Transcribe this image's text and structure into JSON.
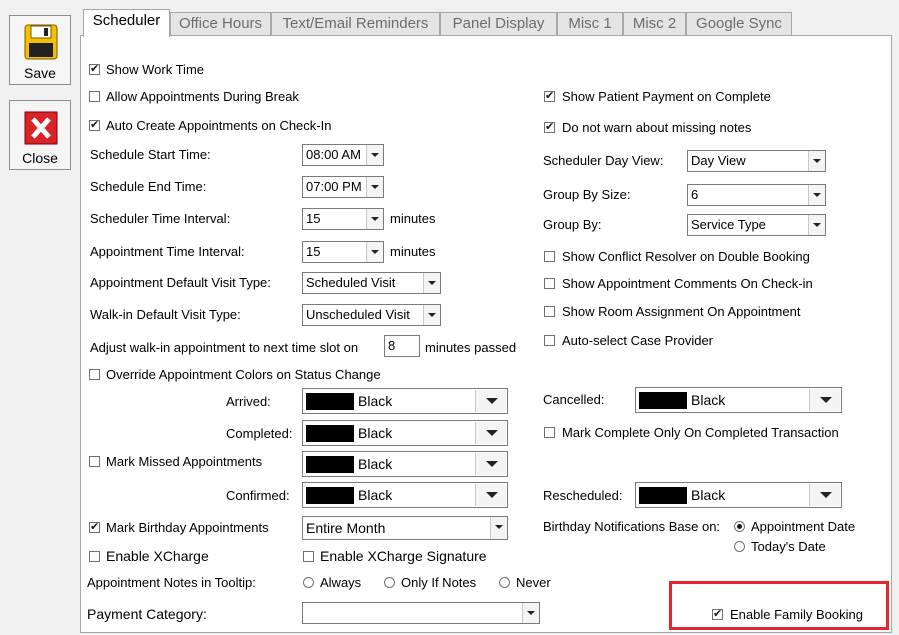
{
  "toolbar": {
    "save_label": "Save",
    "close_label": "Close"
  },
  "tabs": [
    {
      "label": "Scheduler",
      "active": true
    },
    {
      "label": "Office Hours",
      "active": false
    },
    {
      "label": "Text/Email Reminders",
      "active": false
    },
    {
      "label": "Panel Display",
      "active": false
    },
    {
      "label": "Misc 1",
      "active": false
    },
    {
      "label": "Misc 2",
      "active": false
    },
    {
      "label": "Google Sync",
      "active": false
    }
  ],
  "left": {
    "show_work_time": {
      "label": "Show Work Time",
      "checked": true
    },
    "allow_during_break": {
      "label": "Allow Appointments During Break",
      "checked": false
    },
    "auto_create": {
      "label": "Auto Create Appointments on Check-In",
      "checked": true
    },
    "start_time": {
      "label": "Schedule Start Time:",
      "value": "08:00 AM"
    },
    "end_time": {
      "label": "Schedule End Time:",
      "value": "07:00 PM"
    },
    "time_interval": {
      "label": "Scheduler Time Interval:",
      "value": "15",
      "unit": "minutes"
    },
    "appt_interval": {
      "label": "Appointment Time Interval:",
      "value": "15",
      "unit": "minutes"
    },
    "default_visit": {
      "label": "Appointment Default Visit Type:",
      "value": "Scheduled Visit"
    },
    "walkin_visit": {
      "label": "Walk-in Default Visit Type:",
      "value": "Unscheduled Visit"
    },
    "adjust_walkin": {
      "label": "Adjust walk-in appointment to next time slot on",
      "value": "8",
      "suffix": "minutes passed"
    },
    "override_colors": {
      "label": "Override Appointment Colors on Status Change",
      "checked": false
    },
    "arrived": {
      "label": "Arrived:",
      "color": "Black"
    },
    "completed": {
      "label": "Completed:",
      "color": "Black"
    },
    "mark_missed": {
      "label": "Mark Missed Appointments",
      "checked": false,
      "color": "Black"
    },
    "confirmed": {
      "label": "Confirmed:",
      "color": "Black"
    },
    "mark_birthday": {
      "label": "Mark Birthday Appointments",
      "checked": true,
      "value": "Entire Month"
    },
    "enable_xcharge": {
      "label": "Enable XCharge",
      "checked": false
    },
    "enable_xcharge_sig": {
      "label": "Enable XCharge Signature",
      "checked": false
    },
    "notes_tooltip": {
      "label": "Appointment Notes in Tooltip:",
      "options": [
        {
          "label": "Always",
          "checked": false
        },
        {
          "label": "Only If Notes",
          "checked": false
        },
        {
          "label": "Never",
          "checked": false
        }
      ]
    },
    "payment_category": {
      "label": "Payment Category:",
      "value": ""
    }
  },
  "right": {
    "show_payment": {
      "label": "Show Patient Payment on Complete",
      "checked": true
    },
    "no_warn_notes": {
      "label": "Do not warn about missing notes",
      "checked": true
    },
    "day_view": {
      "label": "Scheduler Day View:",
      "value": "Day View"
    },
    "group_size": {
      "label": "Group By Size:",
      "value": "6"
    },
    "group_by": {
      "label": "Group By:",
      "value": "Service Type"
    },
    "conflict_resolver": {
      "label": "Show Conflict Resolver on Double Booking",
      "checked": false
    },
    "appt_comments": {
      "label": "Show Appointment Comments On Check-in",
      "checked": false
    },
    "room_assignment": {
      "label": "Show Room Assignment On Appointment",
      "checked": false
    },
    "auto_select_provider": {
      "label": "Auto-select Case Provider",
      "checked": false
    },
    "cancelled": {
      "label": "Cancelled:",
      "color": "Black"
    },
    "mark_complete_only": {
      "label": "Mark Complete Only On Completed Transaction",
      "checked": false
    },
    "rescheduled": {
      "label": "Rescheduled:",
      "color": "Black"
    },
    "birthday_base": {
      "label": "Birthday Notifications Base on:",
      "options": [
        {
          "label": "Appointment Date",
          "checked": true
        },
        {
          "label": "Today's Date",
          "checked": false
        }
      ]
    },
    "family_booking": {
      "label": "Enable Family Booking",
      "checked": true
    }
  },
  "colors": {
    "highlight": "#e3262f",
    "swatch": "#000000",
    "panel_bg": "#ffffff",
    "window_bg": "#f0f0f0"
  }
}
